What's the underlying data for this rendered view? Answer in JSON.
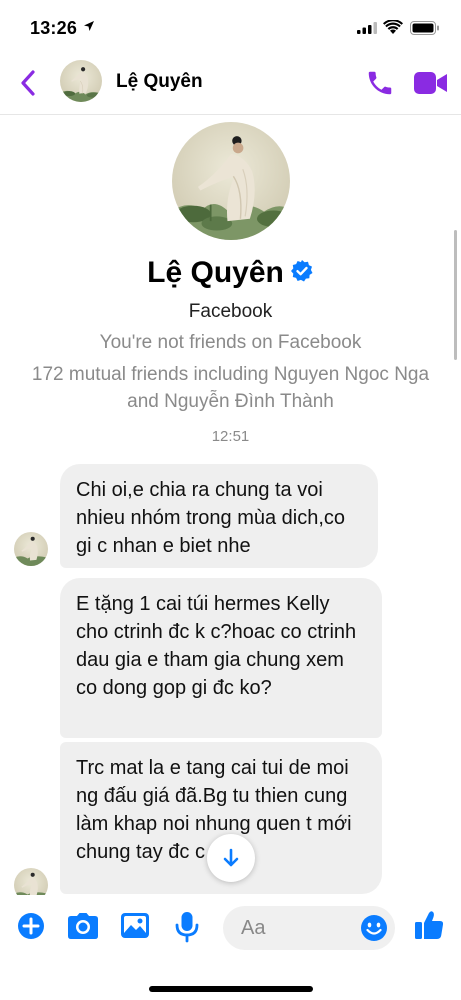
{
  "status_bar": {
    "time": "13:26"
  },
  "header": {
    "contact_name": "Lệ Quyên"
  },
  "profile": {
    "name": "Lệ Quyên",
    "platform": "Facebook",
    "friend_status": "You're not friends on Facebook",
    "mutual_friends": "172 mutual friends including Nguyen Ngoc Nga and Nguyễn Đình Thành"
  },
  "conversation": {
    "timestamp": "12:51",
    "messages": [
      {
        "text": "Chi oi,e chia ra chung ta voi nhieu nhóm trong mùa dich,co gi c nhan e biet nhe"
      },
      {
        "text": "E tặng 1 cai túi hermes Kelly cho ctrinh đc k c?hoac co ctrinh dau gia e tham gia chung xem co dong gop gi đc ko?"
      },
      {
        "text": "Trc mat la e tang cai tui de moi ng đấu giá đã.Bg tu thien cung làm khap noi nhung quen t mới chung tay đc c a"
      }
    ]
  },
  "composer": {
    "placeholder": "Aa"
  },
  "colors": {
    "accent": "#8a2be2",
    "messenger_blue": "#0a7cff",
    "bubble_gray": "#efefef"
  },
  "icons": [
    "back-icon",
    "phone-icon",
    "video-camera-icon",
    "verified-badge-icon",
    "arrow-down-icon",
    "plus-icon",
    "camera-icon",
    "gallery-icon",
    "microphone-icon",
    "emoji-icon",
    "thumbs-up-icon"
  ]
}
